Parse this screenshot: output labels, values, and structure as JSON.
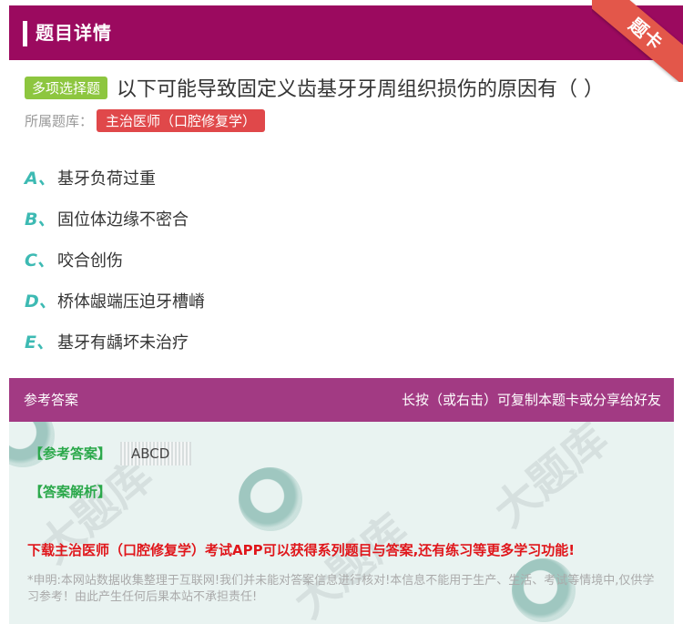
{
  "header": {
    "title": "题目详情",
    "ribbon": "题卡"
  },
  "question": {
    "type": "多项选择题",
    "text": "以下可能导致固定义齿基牙牙周组织损伤的原因有（  ）",
    "bank_label": "所属题库：",
    "bank": "主治医师（口腔修复学）"
  },
  "options": [
    {
      "letter": "A、",
      "text": "基牙负荷过重"
    },
    {
      "letter": "B、",
      "text": "固位体边缘不密合"
    },
    {
      "letter": "C、",
      "text": "咬合创伤"
    },
    {
      "letter": "D、",
      "text": "桥体龈端压迫牙槽嵴"
    },
    {
      "letter": "E、",
      "text": "基牙有龋坏未治疗"
    }
  ],
  "answer": {
    "header_left": "参考答案",
    "header_right": "长按（或右击）可复制本题卡或分享给好友",
    "label": "【参考答案】",
    "value": "ABCD",
    "analysis_label": "【答案解析】",
    "promo": "下载主治医师（口腔修复学）考试APP可以获得系列题目与答案,还有练习等更多学习功能!",
    "disclaimer": "*申明:本网站数据收集整理于互联网!我们并未能对答案信息进行核对!本信息不能用于生产、生活、考试等情境中,仅供学习参考！由此产生任何后果本站不承担责任!"
  },
  "colors": {
    "header_bg": "#9b0a5f",
    "ribbon": "#e3574a",
    "type_badge": "#8dc63f",
    "bank_badge": "#e0484a",
    "option_letter": "#3dbab3",
    "answer_header": "#a23a83",
    "answer_bg": "#e9f3f1",
    "answer_label": "#2aa84a",
    "promo": "#e0161b"
  }
}
